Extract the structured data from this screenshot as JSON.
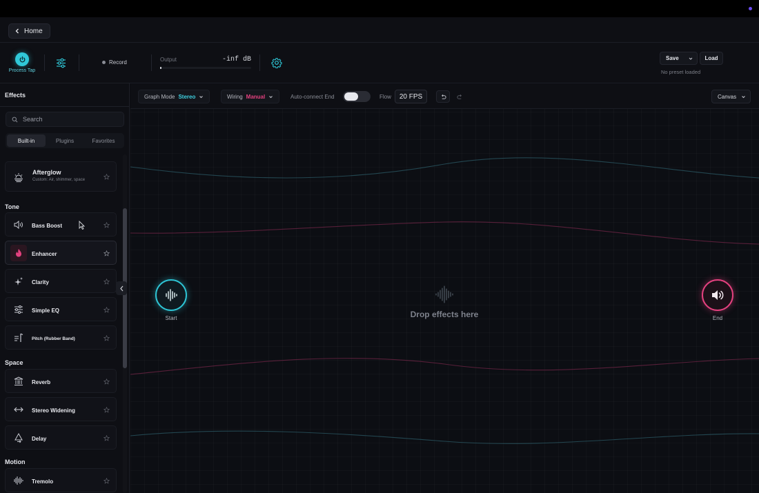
{
  "nav": {
    "home_label": "Home"
  },
  "toolbar": {
    "process_tap_label": "Process Tap",
    "record_label": "Record",
    "output_label": "Output",
    "output_value": "-inf dB",
    "output_level": 0.015,
    "save_label": "Save",
    "load_label": "Load",
    "preset_status": "No preset loaded"
  },
  "sidebar": {
    "title": "Effects",
    "search_placeholder": "Search",
    "tabs": [
      {
        "label": "Built-in",
        "active": true
      },
      {
        "label": "Plugins",
        "active": false
      },
      {
        "label": "Favorites",
        "active": false
      }
    ],
    "afterglow": {
      "name": "Afterglow",
      "subtitle": "Custom: Air, shimmer, space"
    },
    "sections": [
      {
        "title": "Tone",
        "items": [
          {
            "name": "Bass Boost",
            "icon": "speaker-icon"
          },
          {
            "name": "Enhancer",
            "icon": "flame-icon"
          },
          {
            "name": "Clarity",
            "icon": "sparkle-icon"
          },
          {
            "name": "Simple EQ",
            "icon": "eq-sliders-icon"
          },
          {
            "name": "Pitch (Rubber Band)",
            "icon": "pitch-icon"
          }
        ]
      },
      {
        "title": "Space",
        "items": [
          {
            "name": "Reverb",
            "icon": "hall-icon"
          },
          {
            "name": "Stereo Widening",
            "icon": "arrows-horizontal-icon"
          },
          {
            "name": "Delay",
            "icon": "delay-icon"
          }
        ]
      },
      {
        "title": "Motion",
        "items": [
          {
            "name": "Tremolo",
            "icon": "waveform-icon"
          }
        ]
      }
    ]
  },
  "canvas": {
    "graph_mode_label": "Graph Mode",
    "graph_mode_value": "Stereo",
    "wiring_label": "Wiring",
    "wiring_value": "Manual",
    "auto_connect_label": "Auto-connect End",
    "auto_connect_on": false,
    "flow_label": "Flow",
    "flow_value": "20 FPS",
    "view_label": "Canvas",
    "start_label": "Start",
    "end_label": "End",
    "drop_text": "Drop effects here"
  },
  "colors": {
    "accent_cyan": "#2ec4d4",
    "accent_pink": "#e4417f",
    "background": "#0b0c11"
  }
}
